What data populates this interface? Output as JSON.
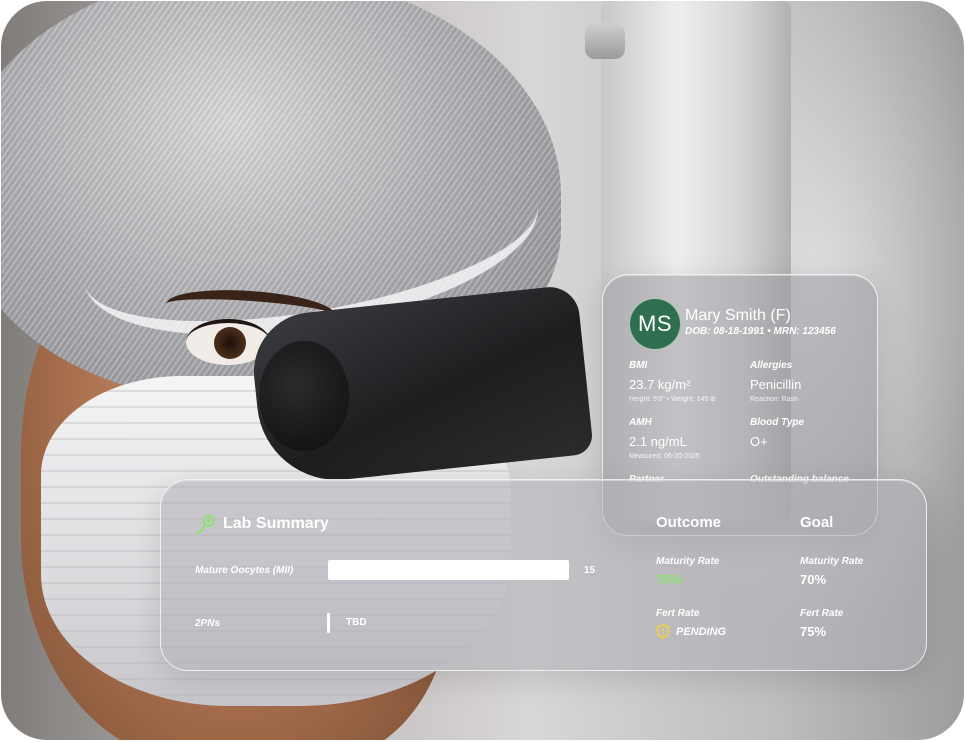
{
  "patient": {
    "initials": "MS",
    "name": "Mary Smith (F)",
    "meta": "DOB: 08-18-1991  •  MRN: 123456",
    "avatar_color": "#2f6f4f",
    "bmi": {
      "label": "BMI",
      "value": "23.7 kg/m²",
      "sub": "Height: 5'6\"  •  Weight: 145 lb"
    },
    "allergies": {
      "label": "Allergies",
      "value": "Penicillin",
      "sub": "Reaction: Rash"
    },
    "amh": {
      "label": "AMH",
      "value": "2.1 ng/mL",
      "sub": "Measured: 06-20-2025"
    },
    "blood_type": {
      "label": "Blood Type",
      "value": "O+"
    },
    "partner": {
      "label": "Partner"
    },
    "balance": {
      "label": "Outstanding balance"
    }
  },
  "lab": {
    "title": "Lab Summary",
    "title_icon": "sperm-icon",
    "rows": [
      {
        "label": "Mature Oocytes (MII)",
        "value": "15"
      },
      {
        "label": "2PNs",
        "value": "TBD"
      }
    ],
    "outcome": {
      "heading": "Outcome",
      "maturity_label": "Maturity Rate",
      "maturity_value": "75%",
      "fert_label": "Fert Rate",
      "fert_value": "PENDING",
      "fert_icon": "shield-alert-icon"
    },
    "goal": {
      "heading": "Goal",
      "maturity_label": "Maturity Rate",
      "maturity_value": "70%",
      "fert_label": "Fert Rate",
      "fert_value": "75%"
    },
    "accent_green": "#8be36b",
    "pending_color": "#f2d23c"
  }
}
